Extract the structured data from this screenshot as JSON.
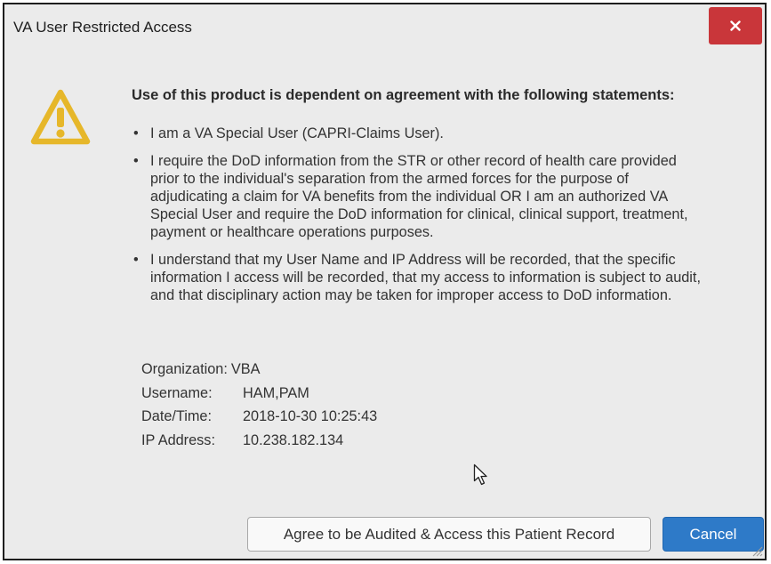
{
  "dialog": {
    "title": "VA User Restricted Access",
    "close_label": "×"
  },
  "content": {
    "icon": "warning-triangle-icon",
    "heading": "Use of this product is dependent on agreement with the following statements:",
    "bullet_glyph": "•",
    "statements": [
      "I am a VA Special User (CAPRI-Claims User).",
      "I require the DoD information from the STR or other record of health care provided prior to the individual's separation from the armed forces for the purpose of adjudicating a claim for VA benefits from the individual OR I am an authorized VA Special User and require the DoD information for clinical, clinical support, treatment, payment or healthcare operations purposes.",
      "I understand that my User Name and IP Address will be recorded, that the specific information I access will be recorded, that my access to information is subject to audit, and that disciplinary action may be taken for improper access to DoD information."
    ]
  },
  "info": {
    "organization_label": "Organization:",
    "organization_value": "VBA",
    "username_label": "Username:",
    "username_value": "HAM,PAM",
    "datetime_label": "Date/Time:",
    "datetime_value": "2018-10-30 10:25:43",
    "ip_label": "IP Address:",
    "ip_value": "10.238.182.134"
  },
  "buttons": {
    "agree_label": "Agree to be Audited & Access this Patient Record",
    "cancel_label": "Cancel"
  },
  "colors": {
    "close_button": "#c9363a",
    "primary_button": "#2e7ac8",
    "warning_icon": "#e6b72a",
    "dialog_background": "#ebebeb"
  }
}
